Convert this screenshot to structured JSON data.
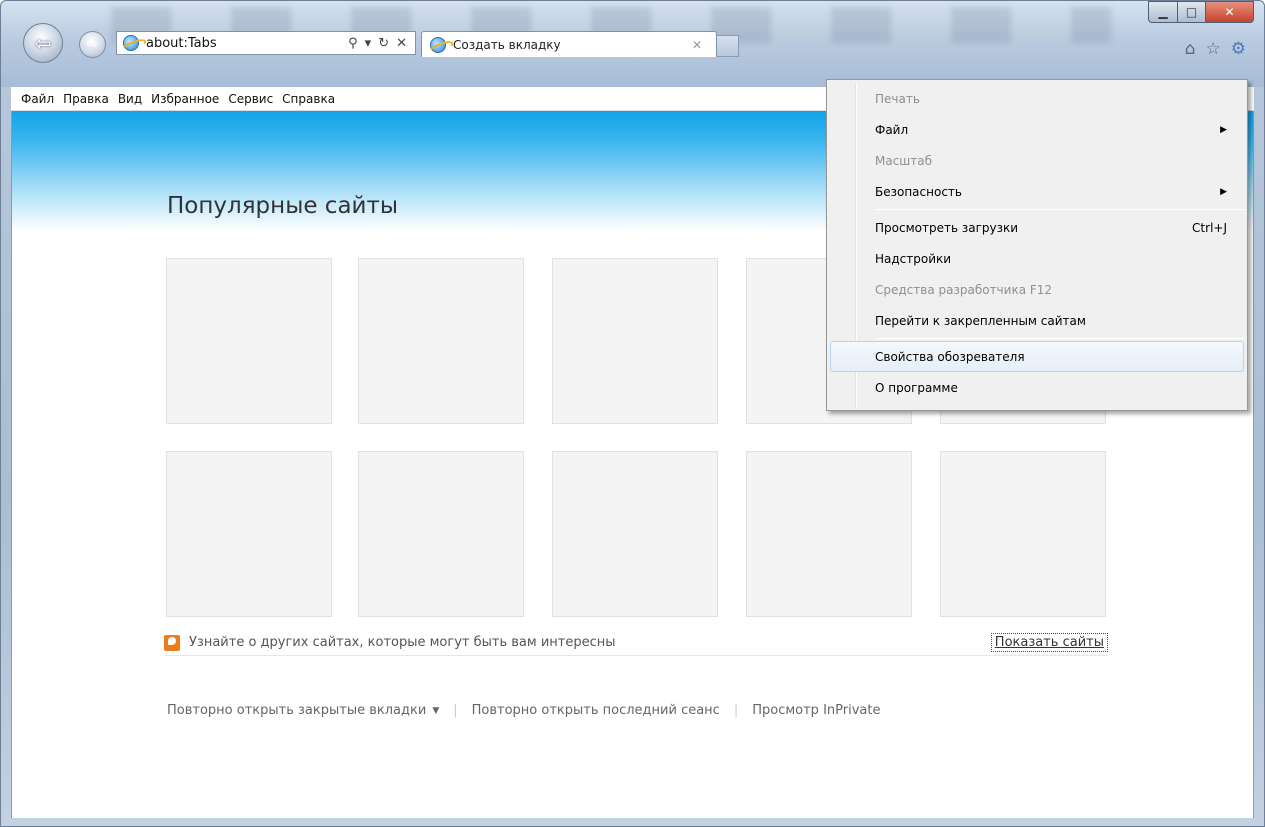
{
  "window": {
    "controls": {
      "minimize": "▁",
      "maximize": "□",
      "close": "✕"
    }
  },
  "nav": {
    "back_glyph": "⇦",
    "forward_glyph": "⇨"
  },
  "address": {
    "value": "about:Tabs",
    "search_glyph": "⚲",
    "dropdown_glyph": "▾",
    "refresh_glyph": "↻",
    "stop_glyph": "✕"
  },
  "tab": {
    "label": "Создать вкладку",
    "close_glyph": "✕"
  },
  "right_icons": {
    "home": "⌂",
    "favorites": "☆",
    "tools": "⚙"
  },
  "menubar": {
    "items": [
      "Файл",
      "Правка",
      "Вид",
      "Избранное",
      "Сервис",
      "Справка"
    ]
  },
  "page": {
    "title": "Популярные сайты",
    "hint_text": "Узнайте о других сайтах, которые могут быть вам интересны",
    "show_sites": "Показать сайты",
    "links": {
      "reopen_tabs": "Повторно открыть закрытые вкладки",
      "reopen_tabs_caret": "▼",
      "reopen_session": "Повторно открыть последний сеанс",
      "inprivate": "Просмотр InPrivate"
    }
  },
  "tools_menu": {
    "items": [
      {
        "label": "Печать",
        "disabled": true
      },
      {
        "label": "Файл",
        "submenu": true,
        "arrow": "▶"
      },
      {
        "label": "Масштаб",
        "disabled": true
      },
      {
        "label": "Безопасность",
        "submenu": true,
        "arrow": "▶"
      },
      {
        "label": "Просмотреть загрузки",
        "shortcut": "Ctrl+J"
      },
      {
        "label": "Надстройки"
      },
      {
        "label": "Средства разработчика F12",
        "disabled": true
      },
      {
        "label": "Перейти к закрепленным сайтам"
      },
      {
        "label": "Свойства обозревателя",
        "highlighted": true
      },
      {
        "label": "О программе"
      }
    ]
  }
}
